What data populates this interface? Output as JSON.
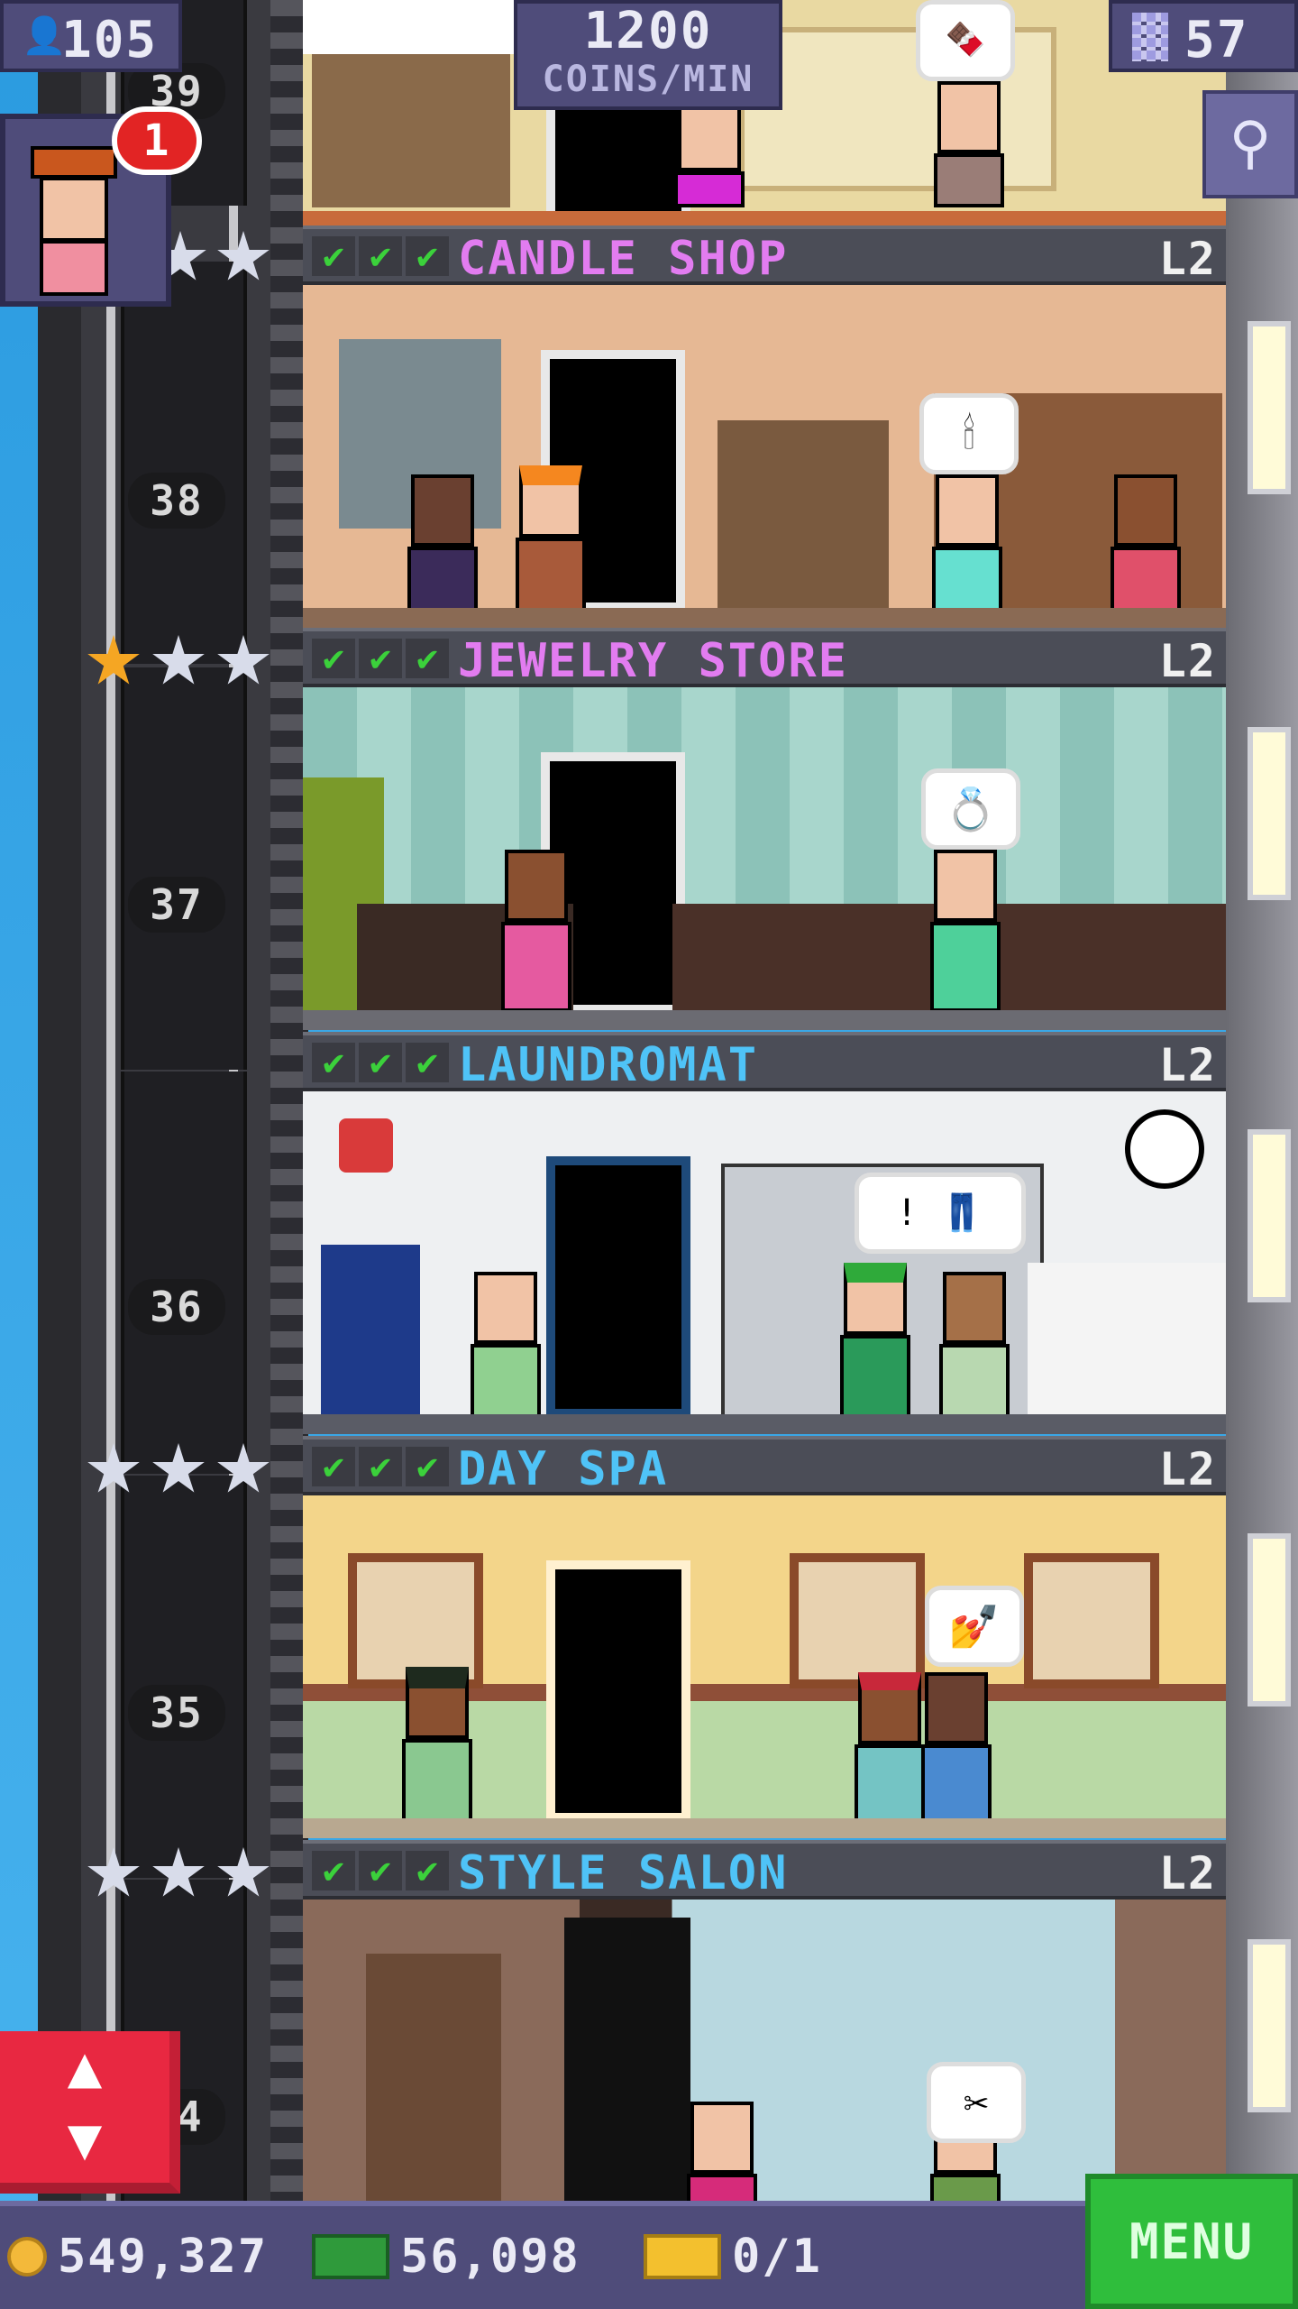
{
  "hud": {
    "population": "105",
    "coins_per_min_value": "1200",
    "coins_per_min_label": "COINS/MIN",
    "floor_count": "57",
    "vip_badge": "1"
  },
  "shaft_numbers": [
    "39",
    "38",
    "37",
    "36",
    "35",
    "34"
  ],
  "floors": [
    {
      "name": "CANDLE SHOP",
      "level": "L2",
      "color": "#e27cf0",
      "checks": [
        "✔",
        "✔",
        "✔"
      ],
      "bubble": "🕯"
    },
    {
      "name": "JEWELRY STORE",
      "level": "L2",
      "color": "#e27cf0",
      "checks": [
        "✔",
        "✔",
        "✔"
      ],
      "bubble": "💍"
    },
    {
      "name": "LAUNDROMAT",
      "level": "L2",
      "color": "#4fc3f7",
      "checks": [
        "✔",
        "✔",
        "✔"
      ],
      "bubble": "! 👖"
    },
    {
      "name": "DAY SPA",
      "level": "L2",
      "color": "#4fc3f7",
      "checks": [
        "✔",
        "✔",
        "✔"
      ],
      "bubble": "💅"
    },
    {
      "name": "STYLE SALON",
      "level": "L2",
      "color": "#4fc3f7",
      "checks": [
        "✔",
        "✔",
        "✔"
      ],
      "bubble": "✂"
    }
  ],
  "bottom_bar": {
    "coins": "549,327",
    "bux": "56,098",
    "tickets": "0/1",
    "menu_label": "MENU"
  },
  "icons": {
    "population": "person-icon",
    "floors": "building-icon",
    "search": "magnifier-icon",
    "elevator": "up-down-arrows-icon"
  }
}
